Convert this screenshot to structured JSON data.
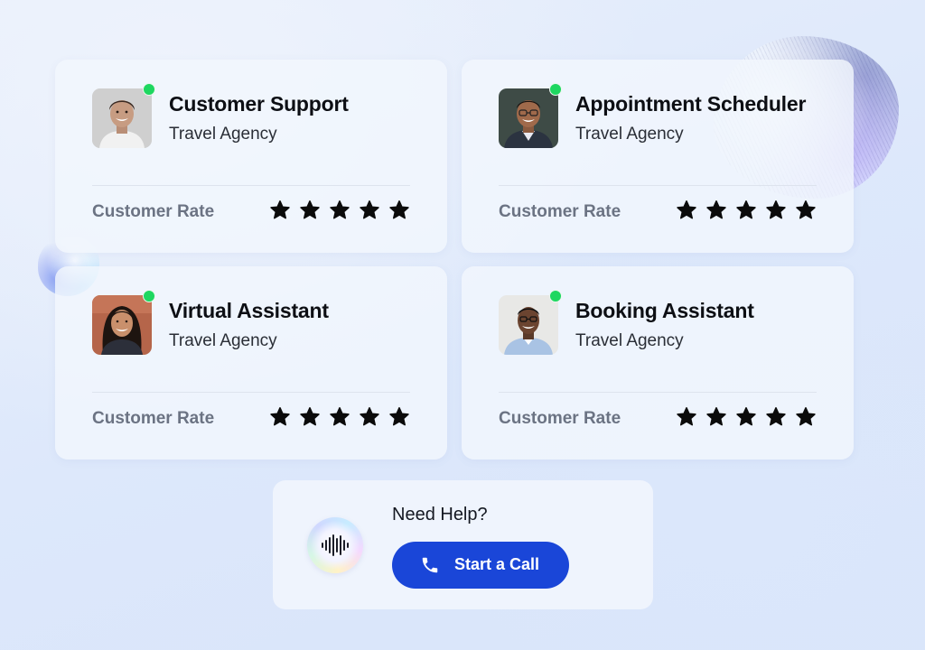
{
  "agents": [
    {
      "name": "Customer Support",
      "company": "Travel Agency",
      "rate_label": "Customer Rate",
      "rating": 5,
      "rating_max": 5,
      "status": "online",
      "avatar_icon": "man-smiling-avatar"
    },
    {
      "name": "Appointment Scheduler",
      "company": "Travel Agency",
      "rate_label": "Customer Rate",
      "rating": 5,
      "rating_max": 5,
      "status": "online",
      "avatar_icon": "man-glasses-avatar"
    },
    {
      "name": "Virtual Assistant",
      "company": "Travel Agency",
      "rate_label": "Customer Rate",
      "rating": 5,
      "rating_max": 5,
      "status": "online",
      "avatar_icon": "woman-smiling-avatar"
    },
    {
      "name": "Booking Assistant",
      "company": "Travel Agency",
      "rate_label": "Customer Rate",
      "rating": 5,
      "rating_max": 5,
      "status": "online",
      "avatar_icon": "man-shirt-avatar"
    }
  ],
  "help": {
    "title": "Need Help?",
    "call_button_label": "Start a Call",
    "orb_icon": "sound-wave-icon",
    "button_icon": "phone-icon"
  },
  "colors": {
    "accent": "#1a46d8",
    "online": "#1ed760",
    "star": "#0b0b0b",
    "muted_text": "#6b7383"
  }
}
